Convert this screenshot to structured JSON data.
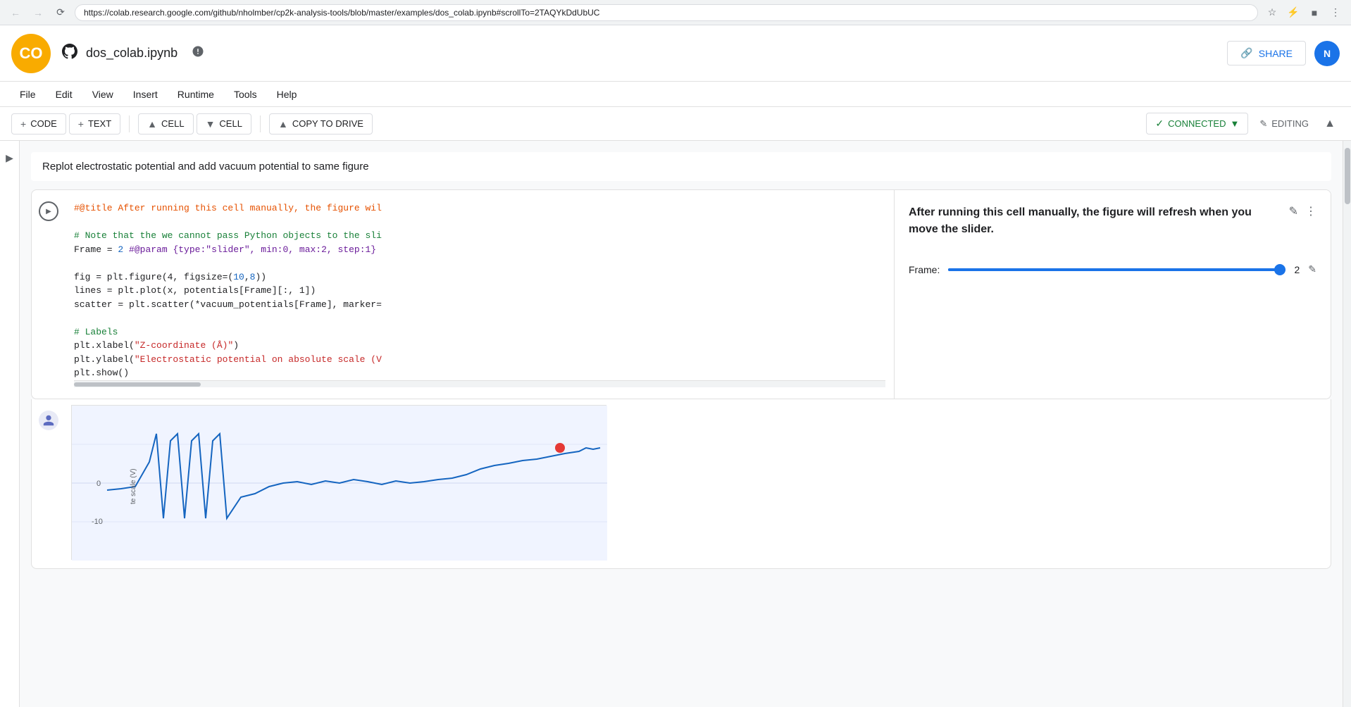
{
  "browser": {
    "url": "https://colab.research.google.com/github/nholmber/cp2k-analysis-tools/blob/master/examples/dos_colab.ipynb#scrollTo=2TAQYkDdUbUC",
    "back_disabled": true,
    "forward_disabled": true
  },
  "header": {
    "logo_text": "CO",
    "github_text": "",
    "file_title": "dos_colab.ipynb",
    "share_label": "SHARE",
    "user_initial": "N"
  },
  "menu": {
    "items": [
      "File",
      "Edit",
      "View",
      "Insert",
      "Runtime",
      "Tools",
      "Help"
    ]
  },
  "toolbar": {
    "code_label": "CODE",
    "text_label": "TEXT",
    "cell_up_label": "CELL",
    "cell_down_label": "CELL",
    "copy_to_drive_label": "COPY TO DRIVE",
    "connected_label": "CONNECTED",
    "editing_label": "EDITING"
  },
  "notebook": {
    "cell_description": "Replot electrostatic potential and add vacuum potential to same figure",
    "code_lines": [
      {
        "type": "decorator",
        "text": "#@title After running this cell manually, the figure wil"
      },
      {
        "type": "blank",
        "text": ""
      },
      {
        "type": "comment",
        "text": "# Note that the we cannot pass Python objects to the sli"
      },
      {
        "type": "mixed",
        "parts": [
          {
            "type": "default",
            "text": "Frame = "
          },
          {
            "type": "number",
            "text": "2"
          },
          {
            "type": "default",
            "text": " "
          },
          {
            "type": "param",
            "text": "#@param {type:\"slider\", min:0, max:2, step:1}"
          }
        ]
      },
      {
        "type": "blank",
        "text": ""
      },
      {
        "type": "mixed",
        "parts": [
          {
            "type": "default",
            "text": "fig = plt.figure(4, figsize=("
          },
          {
            "type": "number",
            "text": "10"
          },
          {
            "type": "default",
            "text": ","
          },
          {
            "type": "number",
            "text": "8"
          },
          {
            "type": "default",
            "text": "))"
          }
        ]
      },
      {
        "type": "default",
        "text": "lines = plt.plot(x, potentials[Frame][:, 1])"
      },
      {
        "type": "default",
        "text": "scatter = plt.scatter(*vacuum_potentials[Frame], marker="
      },
      {
        "type": "blank",
        "text": ""
      },
      {
        "type": "comment",
        "text": "# Labels"
      },
      {
        "type": "mixed",
        "parts": [
          {
            "type": "default",
            "text": "plt.xlabel("
          },
          {
            "type": "string",
            "text": "\"Z-coordinate (Å)\""
          },
          {
            "type": "default",
            "text": ")"
          }
        ]
      },
      {
        "type": "mixed",
        "parts": [
          {
            "type": "default",
            "text": "plt.ylabel("
          },
          {
            "type": "string",
            "text": "\"Electrostatic potential on absolute scale (V"
          },
          {
            "type": "default",
            "text": ""
          }
        ]
      },
      {
        "type": "default",
        "text": "plt.show()"
      }
    ],
    "output_panel": {
      "title": "After running this cell manually, the figure will refresh when you move the slider.",
      "frame_label": "Frame:",
      "frame_value": "2",
      "slider_percent": 100
    }
  }
}
